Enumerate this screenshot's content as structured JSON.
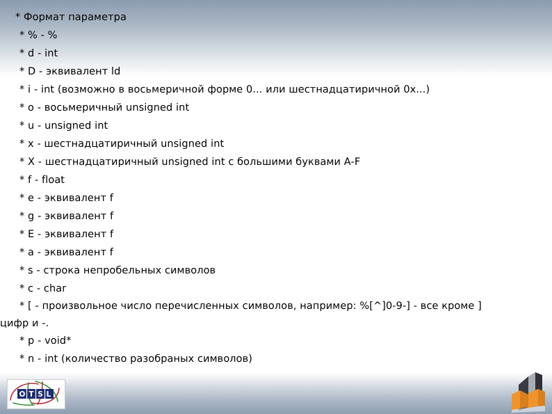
{
  "slide": {
    "background_color": "#ffffff",
    "band_color_top": "#8b9cb0",
    "band_color_bottom": "#8e9fb2",
    "text_color": "#000000"
  },
  "content": {
    "heading": "* Формат параметра",
    "items": [
      "* % - %",
      "* d - int",
      "* D - эквивалент ld",
      "* i - int (возможно в восьмеричной форме 0... или шестнадцатиричной 0x...)",
      "* o - восьмеричный unsigned int",
      "* u - unsigned int",
      "* x - шестнадцатиричный unsigned int",
      "* X - шестнадцатиричный unsigned int с большими буквами A-F",
      "* f - float",
      "* e - эквивалент f",
      "* g - эквивалент f",
      "* E - эквивалент f",
      "* a - эквивалент f",
      "* s - строка непробельных символов",
      "* c - char",
      "* [ - произвольное число перечисленных символов, например: %[^]0-9-] - все кроме ]",
      "цифр и -.",
      "* p - void*",
      "* n - int (количество разобраных символов)"
    ]
  },
  "logo": {
    "name": "otsl-logo",
    "letters": [
      "O",
      "T",
      "S",
      "L"
    ],
    "box_color": "#1f2f6e",
    "letter_color": "#ffffff",
    "arc_red": "#b5303a",
    "arc_green": "#3f8f3f"
  },
  "decoration": {
    "name": "corner-3d-graphic",
    "orange": "#f0932b",
    "dark": "#3a3a42",
    "grey": "#b9bcc3"
  }
}
